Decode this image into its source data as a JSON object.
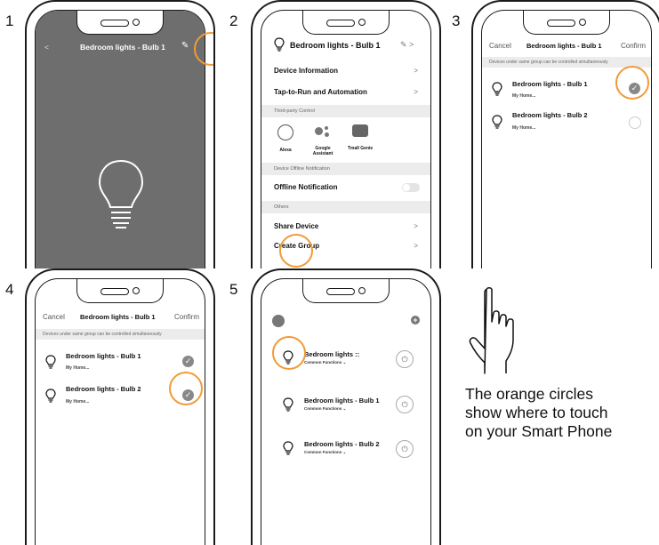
{
  "steps": {
    "s1": "1",
    "s2": "2",
    "s3": "3",
    "s4": "4",
    "s5": "5"
  },
  "panel1": {
    "back": "<",
    "title": "Bedroom lights - Bulb 1",
    "edit": "✎"
  },
  "panel2": {
    "title": "Bedroom lights - Bulb 1",
    "rows": [
      "Device Information",
      "Tap-to-Run and Automation"
    ],
    "third_party_section": "Third-party Control",
    "third_party": [
      "Alexa",
      "Google Assistant",
      "Tmall Genie"
    ],
    "offline_section": "Device Offline Notification",
    "offline_label": "Offline Notification",
    "others_section": "Others",
    "share": "Share Device",
    "create_group": "Create Group"
  },
  "panel3": {
    "cancel": "Cancel",
    "title": "Bedroom lights - Bulb 1",
    "confirm": "Confirm",
    "note": "Devices under same group can be controlled simultaneously",
    "devices": [
      {
        "name": "Bedroom lights - Bulb 1",
        "sub": "My Home..."
      },
      {
        "name": "Bedroom lights - Bulb 2",
        "sub": "My Home..."
      }
    ]
  },
  "panel4": {
    "cancel": "Cancel",
    "title": "Bedroom lights - Bulb 1",
    "confirm": "Confirm",
    "note": "Devices under same group can be controlled simultaneously",
    "devices": [
      {
        "name": "Bedroom lights - Bulb 1",
        "sub": "My Home..."
      },
      {
        "name": "Bedroom lights - Bulb 2",
        "sub": "My Home..."
      }
    ]
  },
  "panel5": {
    "add": "+",
    "items": [
      {
        "name": "Bedroom lights ::",
        "sub": "Common Functions ⌄"
      },
      {
        "name": "Bedroom lights - Bulb 1",
        "sub": "Common Functions ⌄"
      },
      {
        "name": "Bedroom lights - Bulb 2",
        "sub": "Common Functions ⌄"
      }
    ]
  },
  "caption": {
    "line1": "The orange circles",
    "line2": "show where to touch",
    "line3": "on your Smart Phone"
  },
  "colors": {
    "highlight": "#f29a38",
    "dark_screen": "#6e6e6e"
  },
  "icons": [
    "bulb-icon",
    "check-icon",
    "power-icon",
    "hand-pointer-icon"
  ]
}
